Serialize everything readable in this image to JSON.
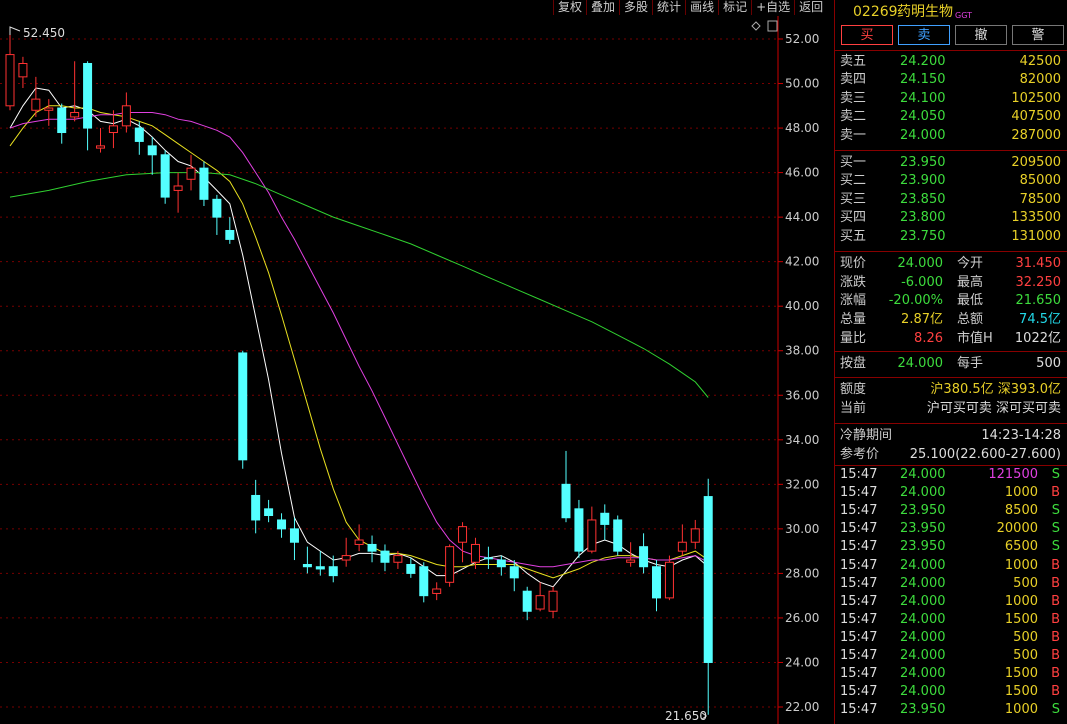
{
  "toolbar": [
    "复权",
    "叠加",
    "多股",
    "统计",
    "画线",
    "标记",
    "+自选",
    "返回"
  ],
  "header": {
    "code": "02269",
    "name": "药明生物",
    "tag": "GGT"
  },
  "buttons": {
    "buy": "买",
    "sell": "卖",
    "cancel": "撤",
    "alert": "警"
  },
  "asks": [
    {
      "label": "卖五",
      "price": "24.200",
      "vol": "42500"
    },
    {
      "label": "卖四",
      "price": "24.150",
      "vol": "82000"
    },
    {
      "label": "卖三",
      "price": "24.100",
      "vol": "102500"
    },
    {
      "label": "卖二",
      "price": "24.050",
      "vol": "407500"
    },
    {
      "label": "卖一",
      "price": "24.000",
      "vol": "287000"
    }
  ],
  "bids": [
    {
      "label": "买一",
      "price": "23.950",
      "vol": "209500"
    },
    {
      "label": "买二",
      "price": "23.900",
      "vol": "85000"
    },
    {
      "label": "买三",
      "price": "23.850",
      "vol": "78500"
    },
    {
      "label": "买四",
      "price": "23.800",
      "vol": "133500"
    },
    {
      "label": "买五",
      "price": "23.750",
      "vol": "131000"
    }
  ],
  "quote": {
    "now_l": "现价",
    "now": "24.000",
    "open_l": "今开",
    "open": "31.450",
    "chg_l": "涨跌",
    "chg": "-6.000",
    "high_l": "最高",
    "high": "32.250",
    "pct_l": "涨幅",
    "pct": "-20.00%",
    "low_l": "最低",
    "low": "21.650",
    "vol_l": "总量",
    "vol": "2.87亿",
    "amt_l": "总额",
    "amt": "74.5亿",
    "ratio_l": "量比",
    "ratio": "8.26",
    "mcap_l": "市值H",
    "mcap": "1022亿",
    "close_l": "按盘",
    "close": "24.000",
    "lot_l": "每手",
    "lot": "500"
  },
  "quota": {
    "label1": "额度",
    "val1": "沪380.5亿 深393.0亿",
    "label2": "当前",
    "val2": "沪可买可卖 深可买可卖"
  },
  "vcm": {
    "label1": "冷静期间",
    "val1": "14:23-14:28",
    "label2": "参考价",
    "val2": "25.100(22.600-27.600)"
  },
  "ticks": [
    {
      "t": "15:47",
      "p": "24.000",
      "v": "121500",
      "s": "S"
    },
    {
      "t": "15:47",
      "p": "24.000",
      "v": "1000",
      "s": "B"
    },
    {
      "t": "15:47",
      "p": "23.950",
      "v": "8500",
      "s": "S"
    },
    {
      "t": "15:47",
      "p": "23.950",
      "v": "20000",
      "s": "S"
    },
    {
      "t": "15:47",
      "p": "23.950",
      "v": "6500",
      "s": "S"
    },
    {
      "t": "15:47",
      "p": "24.000",
      "v": "1000",
      "s": "B"
    },
    {
      "t": "15:47",
      "p": "24.000",
      "v": "500",
      "s": "B"
    },
    {
      "t": "15:47",
      "p": "24.000",
      "v": "1000",
      "s": "B"
    },
    {
      "t": "15:47",
      "p": "24.000",
      "v": "1500",
      "s": "B"
    },
    {
      "t": "15:47",
      "p": "24.000",
      "v": "500",
      "s": "B"
    },
    {
      "t": "15:47",
      "p": "24.000",
      "v": "500",
      "s": "B"
    },
    {
      "t": "15:47",
      "p": "24.000",
      "v": "1500",
      "s": "B"
    },
    {
      "t": "15:47",
      "p": "24.000",
      "v": "1500",
      "s": "B"
    },
    {
      "t": "15:47",
      "p": "23.950",
      "v": "1000",
      "s": "S"
    }
  ],
  "chart_data": {
    "type": "candlestick",
    "ylim": [
      21.5,
      53.5
    ],
    "y_ticks": [
      "52.00",
      "50.00",
      "48.00",
      "46.00",
      "44.00",
      "42.00",
      "40.00",
      "38.00",
      "36.00",
      "34.00",
      "32.00",
      "30.00",
      "28.00",
      "26.00",
      "24.00",
      "22.00"
    ],
    "high_label": "52.450",
    "low_label": "21.650",
    "candles": [
      {
        "o": 49.0,
        "c": 51.3,
        "h": 52.45,
        "l": 48.8
      },
      {
        "o": 50.3,
        "c": 50.9,
        "h": 51.2,
        "l": 49.8
      },
      {
        "o": 48.8,
        "c": 49.3,
        "h": 50.3,
        "l": 48.5
      },
      {
        "o": 48.8,
        "c": 48.9,
        "h": 49.3,
        "l": 48.1
      },
      {
        "o": 48.9,
        "c": 47.8,
        "h": 49.1,
        "l": 47.3
      },
      {
        "o": 48.5,
        "c": 48.7,
        "h": 51.0,
        "l": 48.3
      },
      {
        "o": 50.9,
        "c": 48.0,
        "h": 51.0,
        "l": 47.0
      },
      {
        "o": 47.1,
        "c": 47.2,
        "h": 48.0,
        "l": 46.9
      },
      {
        "o": 47.8,
        "c": 48.1,
        "h": 48.8,
        "l": 47.1
      },
      {
        "o": 48.1,
        "c": 49.0,
        "h": 49.6,
        "l": 47.8
      },
      {
        "o": 48.0,
        "c": 47.4,
        "h": 48.3,
        "l": 46.8
      },
      {
        "o": 47.2,
        "c": 46.8,
        "h": 47.6,
        "l": 45.9
      },
      {
        "o": 46.8,
        "c": 44.9,
        "h": 47.0,
        "l": 44.6
      },
      {
        "o": 45.2,
        "c": 45.4,
        "h": 46.0,
        "l": 44.2
      },
      {
        "o": 45.7,
        "c": 46.2,
        "h": 46.8,
        "l": 45.2
      },
      {
        "o": 46.2,
        "c": 44.8,
        "h": 46.5,
        "l": 44.5
      },
      {
        "o": 44.8,
        "c": 44.0,
        "h": 45.0,
        "l": 43.2
      },
      {
        "o": 43.4,
        "c": 43.0,
        "h": 44.0,
        "l": 42.8
      },
      {
        "o": 37.9,
        "c": 33.1,
        "h": 38.0,
        "l": 32.7
      },
      {
        "o": 31.5,
        "c": 30.4,
        "h": 32.2,
        "l": 29.8
      },
      {
        "o": 30.9,
        "c": 30.6,
        "h": 31.3,
        "l": 30.3
      },
      {
        "o": 30.4,
        "c": 30.0,
        "h": 30.7,
        "l": 29.6
      },
      {
        "o": 30.0,
        "c": 29.4,
        "h": 30.5,
        "l": 28.6
      },
      {
        "o": 28.4,
        "c": 28.3,
        "h": 29.2,
        "l": 28.0
      },
      {
        "o": 28.3,
        "c": 28.2,
        "h": 29.0,
        "l": 27.9
      },
      {
        "o": 28.3,
        "c": 27.9,
        "h": 28.8,
        "l": 27.6
      },
      {
        "o": 28.6,
        "c": 28.8,
        "h": 29.6,
        "l": 28.3
      },
      {
        "o": 29.3,
        "c": 29.5,
        "h": 30.2,
        "l": 29.0
      },
      {
        "o": 29.3,
        "c": 29.0,
        "h": 29.7,
        "l": 28.5
      },
      {
        "o": 29.0,
        "c": 28.5,
        "h": 29.3,
        "l": 28.1
      },
      {
        "o": 28.5,
        "c": 28.8,
        "h": 29.0,
        "l": 28.2
      },
      {
        "o": 28.4,
        "c": 28.0,
        "h": 28.7,
        "l": 27.8
      },
      {
        "o": 28.3,
        "c": 27.0,
        "h": 28.5,
        "l": 26.7
      },
      {
        "o": 27.1,
        "c": 27.3,
        "h": 27.6,
        "l": 26.8
      },
      {
        "o": 27.6,
        "c": 29.2,
        "h": 29.3,
        "l": 27.4
      },
      {
        "o": 29.4,
        "c": 30.1,
        "h": 30.3,
        "l": 28.5
      },
      {
        "o": 28.5,
        "c": 29.3,
        "h": 29.6,
        "l": 28.2
      },
      {
        "o": 28.7,
        "c": 28.7,
        "h": 29.2,
        "l": 28.2
      },
      {
        "o": 28.6,
        "c": 28.3,
        "h": 28.8,
        "l": 27.9
      },
      {
        "o": 28.3,
        "c": 27.8,
        "h": 28.6,
        "l": 27.2
      },
      {
        "o": 27.2,
        "c": 26.3,
        "h": 27.4,
        "l": 25.9
      },
      {
        "o": 26.4,
        "c": 27.0,
        "h": 27.6,
        "l": 26.3
      },
      {
        "o": 26.3,
        "c": 27.2,
        "h": 27.4,
        "l": 26.0
      },
      {
        "o": 32.0,
        "c": 30.5,
        "h": 33.5,
        "l": 30.3
      },
      {
        "o": 30.9,
        "c": 29.0,
        "h": 31.3,
        "l": 28.7
      },
      {
        "o": 29.0,
        "c": 30.4,
        "h": 31.0,
        "l": 28.9
      },
      {
        "o": 30.7,
        "c": 30.2,
        "h": 31.1,
        "l": 29.5
      },
      {
        "o": 30.4,
        "c": 29.0,
        "h": 30.6,
        "l": 28.8
      },
      {
        "o": 28.5,
        "c": 28.6,
        "h": 29.4,
        "l": 28.3
      },
      {
        "o": 29.2,
        "c": 28.3,
        "h": 29.8,
        "l": 28.0
      },
      {
        "o": 28.3,
        "c": 26.9,
        "h": 28.6,
        "l": 26.3
      },
      {
        "o": 26.9,
        "c": 28.5,
        "h": 28.8,
        "l": 26.8
      },
      {
        "o": 29.0,
        "c": 29.4,
        "h": 30.2,
        "l": 28.8
      },
      {
        "o": 29.4,
        "c": 30.0,
        "h": 30.4,
        "l": 29.1
      },
      {
        "o": 31.45,
        "c": 24.0,
        "h": 32.25,
        "l": 21.65
      }
    ],
    "ma_series": [
      {
        "color": "#ffffff",
        "points": [
          [
            0,
            48.0
          ],
          [
            1,
            49.0
          ],
          [
            2,
            49.8
          ],
          [
            3,
            49.7
          ],
          [
            4,
            48.9
          ],
          [
            5,
            49.0
          ],
          [
            6,
            48.8
          ],
          [
            7,
            48.3
          ],
          [
            8,
            48.2
          ],
          [
            9,
            48.4
          ],
          [
            10,
            48.1
          ],
          [
            11,
            47.6
          ],
          [
            12,
            47.0
          ],
          [
            13,
            46.5
          ],
          [
            14,
            46.3
          ],
          [
            15,
            45.8
          ],
          [
            16,
            45.2
          ],
          [
            17,
            44.6
          ],
          [
            18,
            42.3
          ],
          [
            19,
            39.5
          ],
          [
            20,
            36.7
          ],
          [
            21,
            33.4
          ],
          [
            22,
            30.5
          ],
          [
            23,
            29.4
          ],
          [
            24,
            29.0
          ],
          [
            25,
            28.6
          ],
          [
            26,
            28.7
          ],
          [
            27,
            28.9
          ],
          [
            28,
            28.9
          ],
          [
            29,
            28.8
          ],
          [
            30,
            28.9
          ],
          [
            31,
            28.7
          ],
          [
            32,
            28.3
          ],
          [
            33,
            27.9
          ],
          [
            34,
            27.9
          ],
          [
            35,
            28.2
          ],
          [
            36,
            28.5
          ],
          [
            37,
            28.7
          ],
          [
            38,
            28.8
          ],
          [
            39,
            28.5
          ],
          [
            40,
            28.0
          ],
          [
            41,
            27.6
          ],
          [
            42,
            27.4
          ],
          [
            43,
            28.1
          ],
          [
            44,
            28.8
          ],
          [
            45,
            29.3
          ],
          [
            46,
            29.5
          ],
          [
            47,
            29.3
          ],
          [
            48,
            28.9
          ],
          [
            49,
            28.6
          ],
          [
            50,
            28.4
          ],
          [
            51,
            28.3
          ],
          [
            52,
            28.6
          ],
          [
            53,
            28.8
          ],
          [
            54,
            28.3
          ]
        ]
      },
      {
        "color": "#e8e020",
        "points": [
          [
            0,
            47.2
          ],
          [
            1,
            48.0
          ],
          [
            2,
            48.7
          ],
          [
            3,
            49.0
          ],
          [
            4,
            49.0
          ],
          [
            5,
            48.9
          ],
          [
            6,
            48.9
          ],
          [
            7,
            48.7
          ],
          [
            8,
            48.6
          ],
          [
            9,
            48.5
          ],
          [
            10,
            48.3
          ],
          [
            11,
            48.1
          ],
          [
            12,
            47.7
          ],
          [
            13,
            47.3
          ],
          [
            14,
            46.9
          ],
          [
            15,
            46.5
          ],
          [
            16,
            46.1
          ],
          [
            17,
            45.6
          ],
          [
            18,
            44.6
          ],
          [
            19,
            43.1
          ],
          [
            20,
            41.5
          ],
          [
            21,
            39.6
          ],
          [
            22,
            37.6
          ],
          [
            23,
            35.6
          ],
          [
            24,
            33.6
          ],
          [
            25,
            31.8
          ],
          [
            26,
            30.3
          ],
          [
            27,
            29.5
          ],
          [
            28,
            29.2
          ],
          [
            29,
            28.9
          ],
          [
            30,
            28.9
          ],
          [
            31,
            28.8
          ],
          [
            32,
            28.6
          ],
          [
            33,
            28.4
          ],
          [
            34,
            28.3
          ],
          [
            35,
            28.3
          ],
          [
            36,
            28.4
          ],
          [
            37,
            28.4
          ],
          [
            38,
            28.4
          ],
          [
            39,
            28.4
          ],
          [
            40,
            28.2
          ],
          [
            41,
            28.0
          ],
          [
            42,
            27.8
          ],
          [
            43,
            28.0
          ],
          [
            44,
            28.2
          ],
          [
            45,
            28.5
          ],
          [
            46,
            28.7
          ],
          [
            47,
            28.8
          ],
          [
            48,
            28.8
          ],
          [
            49,
            28.7
          ],
          [
            50,
            28.6
          ],
          [
            51,
            28.6
          ],
          [
            52,
            28.8
          ],
          [
            53,
            29.0
          ],
          [
            54,
            28.6
          ]
        ]
      },
      {
        "color": "#e040e0",
        "points": [
          [
            0,
            48.0
          ],
          [
            1,
            48.2
          ],
          [
            2,
            48.3
          ],
          [
            3,
            48.4
          ],
          [
            4,
            48.4
          ],
          [
            5,
            48.4
          ],
          [
            6,
            48.5
          ],
          [
            7,
            48.6
          ],
          [
            8,
            48.6
          ],
          [
            9,
            48.7
          ],
          [
            10,
            48.7
          ],
          [
            11,
            48.7
          ],
          [
            12,
            48.6
          ],
          [
            13,
            48.4
          ],
          [
            14,
            48.3
          ],
          [
            15,
            48.1
          ],
          [
            16,
            47.9
          ],
          [
            17,
            47.6
          ],
          [
            18,
            46.9
          ],
          [
            19,
            46.0
          ],
          [
            20,
            45.1
          ],
          [
            21,
            44.0
          ],
          [
            22,
            43.0
          ],
          [
            23,
            41.9
          ],
          [
            24,
            40.8
          ],
          [
            25,
            39.7
          ],
          [
            26,
            38.5
          ],
          [
            27,
            37.3
          ],
          [
            28,
            36.2
          ],
          [
            29,
            35.0
          ],
          [
            30,
            33.8
          ],
          [
            31,
            32.6
          ],
          [
            32,
            31.4
          ],
          [
            33,
            30.3
          ],
          [
            34,
            29.5
          ],
          [
            35,
            29.0
          ],
          [
            36,
            28.8
          ],
          [
            37,
            28.7
          ],
          [
            38,
            28.6
          ],
          [
            39,
            28.5
          ],
          [
            40,
            28.4
          ],
          [
            41,
            28.3
          ],
          [
            42,
            28.3
          ],
          [
            43,
            28.4
          ],
          [
            44,
            28.5
          ],
          [
            45,
            28.6
          ],
          [
            46,
            28.6
          ],
          [
            47,
            28.7
          ],
          [
            48,
            28.7
          ],
          [
            49,
            28.7
          ],
          [
            50,
            28.6
          ],
          [
            51,
            28.6
          ],
          [
            52,
            28.7
          ],
          [
            53,
            28.8
          ],
          [
            54,
            28.5
          ]
        ]
      },
      {
        "color": "#30d030",
        "points": [
          [
            0,
            44.9
          ],
          [
            3,
            45.2
          ],
          [
            6,
            45.6
          ],
          [
            9,
            45.9
          ],
          [
            12,
            46.0
          ],
          [
            15,
            46.0
          ],
          [
            17,
            45.9
          ],
          [
            19,
            45.5
          ],
          [
            21,
            45.0
          ],
          [
            23,
            44.5
          ],
          [
            25,
            44.0
          ],
          [
            27,
            43.6
          ],
          [
            29,
            43.2
          ],
          [
            31,
            42.8
          ],
          [
            33,
            42.3
          ],
          [
            35,
            41.8
          ],
          [
            37,
            41.3
          ],
          [
            39,
            40.8
          ],
          [
            41,
            40.3
          ],
          [
            43,
            39.8
          ],
          [
            45,
            39.3
          ],
          [
            47,
            38.7
          ],
          [
            49,
            38.1
          ],
          [
            51,
            37.4
          ],
          [
            53,
            36.6
          ],
          [
            54,
            35.9
          ]
        ]
      }
    ]
  }
}
